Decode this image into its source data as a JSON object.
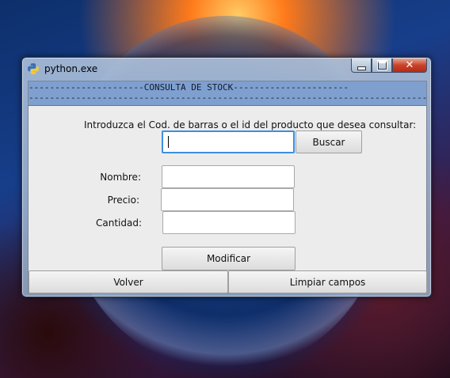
{
  "window": {
    "title": "python.exe",
    "controls": {
      "minimize_icon": "minimize-icon",
      "maximize_icon": "maximize-icon",
      "close_icon": "close-icon"
    }
  },
  "banner": {
    "top_line": "----------------------CONSULTA DE STOCK----------------------",
    "bottom_line": "------------------------------------------------------------------------------------",
    "title": "CONSULTA DE STOCK"
  },
  "form": {
    "instruction": "Introduzca el Cod. de barras o el id del producto que desea consultar:",
    "search_input_value": "",
    "search_button": "Buscar",
    "fields": [
      {
        "label": "Nombre:",
        "value": ""
      },
      {
        "label": "Precio:",
        "value": ""
      },
      {
        "label": "Cantidad:",
        "value": ""
      }
    ],
    "modify_button": "Modificar"
  },
  "footer": {
    "back_button": "Volver",
    "clear_button": "Limpiar campos"
  },
  "colors": {
    "banner": "#7f9fcf",
    "focus_border": "#3d8ee0",
    "client_bg": "#ececec"
  }
}
